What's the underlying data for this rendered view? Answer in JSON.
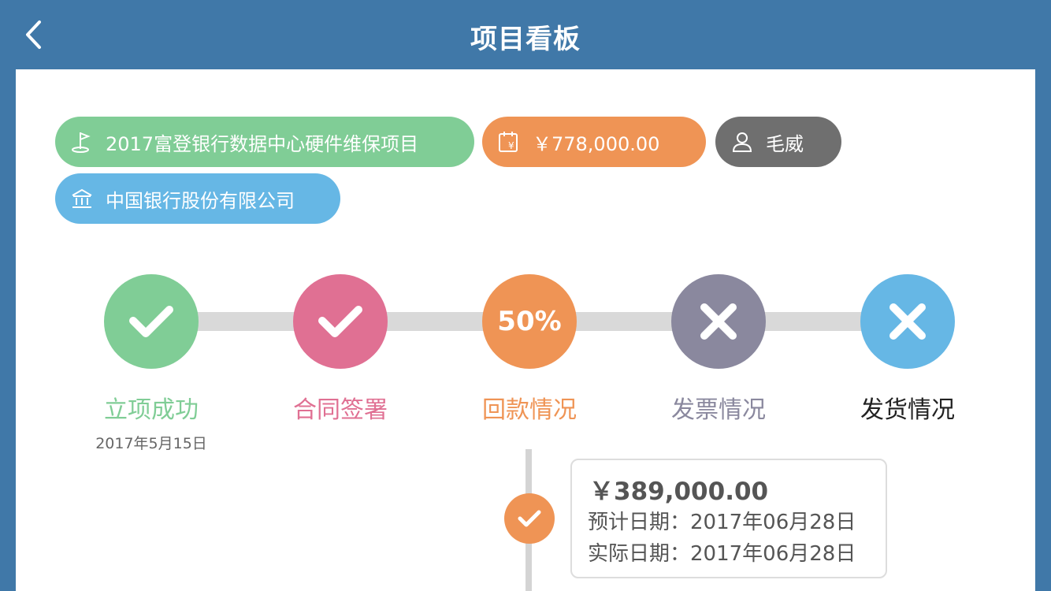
{
  "header": {
    "title": "项目看板",
    "back_icon": "chevron-left-icon"
  },
  "tags": {
    "project": {
      "label": "2017富登银行数据中心硬件维保项目",
      "icon": "flag-icon",
      "color": "#80cd96"
    },
    "amount": {
      "label": "￥778,000.00",
      "icon": "calendar-yen-icon",
      "color": "#ef9455"
    },
    "person": {
      "label": "毛威",
      "icon": "user-icon",
      "color": "#6f6f6f"
    },
    "bank": {
      "label": "中国银行股份有限公司",
      "icon": "bank-icon",
      "color": "#66b7e5"
    }
  },
  "steps": [
    {
      "label": "立项成功",
      "status": "done",
      "color": "#80cd96",
      "date": "2017年5月15日"
    },
    {
      "label": "合同签署",
      "status": "done",
      "color": "#e07093"
    },
    {
      "label": "回款情况",
      "status": "partial",
      "progress_text": "50%",
      "color": "#ef9455"
    },
    {
      "label": "发票情况",
      "status": "not-done",
      "color": "#8a889e"
    },
    {
      "label": "发货情况",
      "status": "not-done",
      "color": "#66b7e5",
      "label_color": "#222222"
    }
  ],
  "payments": [
    {
      "amount": "￥389,000.00",
      "planned": "预计日期：2017年06月28日",
      "actual": "实际日期：2017年06月28日",
      "status": "done"
    }
  ]
}
